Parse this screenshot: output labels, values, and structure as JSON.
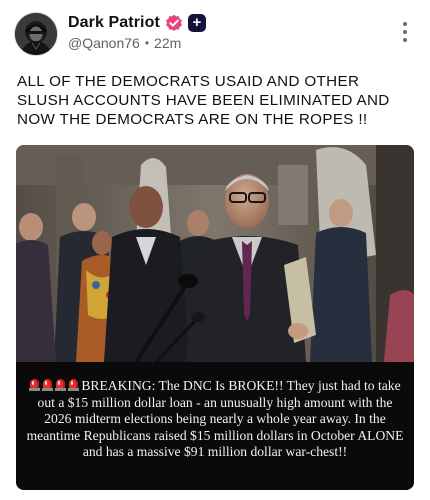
{
  "post": {
    "author": {
      "display_name": "Dark Patriot",
      "handle": "@Qanon76",
      "separator": "•",
      "time_ago": "22m",
      "avatar_icon": "hooded-figure-avatar",
      "badges": [
        "verified-icon",
        "plus-icon"
      ],
      "verified_color": "#e8457a",
      "plus_badge_color": "#15133a",
      "plus_badge_label": "+"
    },
    "menu_icon": "more-vertical-icon",
    "text": "ALL OF THE DEMOCRATS USAID AND OTHER SLUSH ACCOUNTS HAVE BEEN ELIMINATED AND NOW THE DEMOCRATS ARE ON THE ROPES !!",
    "media": {
      "photo_icon": "press-conference-photo",
      "caption_prefix_icons": [
        "siren-icon",
        "siren-icon",
        "siren-icon",
        "siren-icon"
      ],
      "caption": "BREAKING: The DNC Is BROKE!! They just had to take out a $15 million dollar loan - an unusually high amount with the 2026 midterm elections being nearly a whole year away. In the meantime Republicans raised $15 million dollars in October ALONE and has a massive $91 million dollar war-chest!!"
    }
  }
}
